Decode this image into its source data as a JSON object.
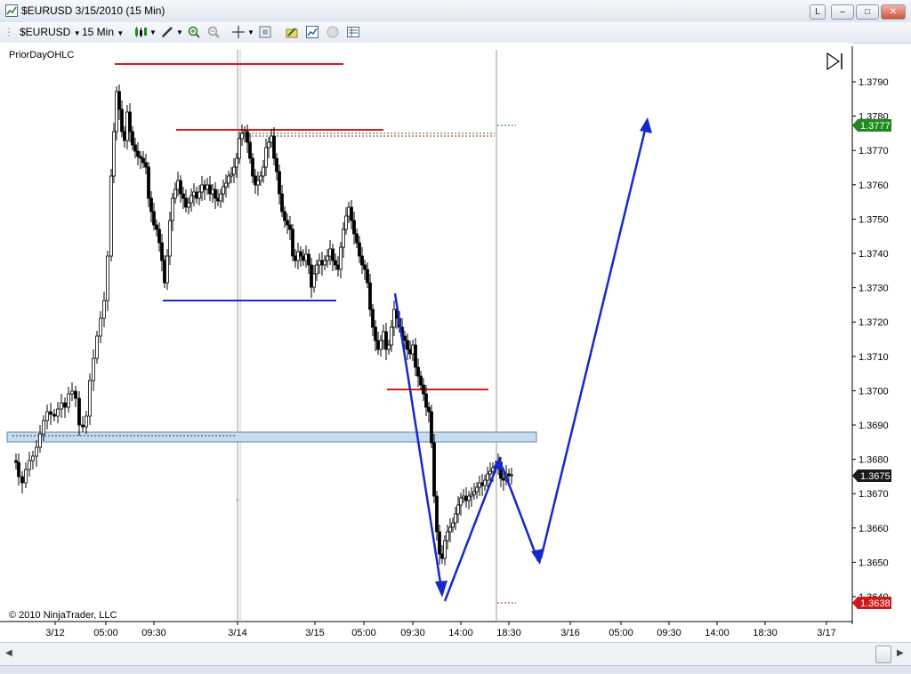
{
  "window": {
    "title": "$EURUSD  3/15/2010 (15 Min)",
    "controls": {
      "link": "L",
      "minimize": "–",
      "maximize": "□",
      "close": "✕"
    }
  },
  "toolbar": {
    "instrument": "$EURUSD",
    "interval": "15 Min",
    "icons": [
      "bar-style-icon",
      "draw-pencil-icon",
      "zoom-in-icon",
      "zoom-out-icon",
      "crosshair-icon",
      "properties-icon",
      "strategy-icon",
      "chart-trader-icon",
      "ellipse-icon",
      "data-box-icon"
    ]
  },
  "chart": {
    "indicator_label": "PriorDayOHLC",
    "copyright": "© 2010 NinjaTrader, LLC",
    "y_ticks": [
      "1.3790",
      "1.3780",
      "1.3770",
      "1.3760",
      "1.3750",
      "1.3740",
      "1.3730",
      "1.3720",
      "1.3710",
      "1.3700",
      "1.3690",
      "1.3680",
      "1.3670",
      "1.3660",
      "1.3650",
      "1.3640"
    ],
    "x_ticks": [
      "3/12",
      "05:00",
      "09:30",
      "3/14",
      "3/15",
      "05:00",
      "09:30",
      "14:00",
      "18:30",
      "3/16",
      "05:00",
      "09:30",
      "14:00",
      "18:30",
      "3/17"
    ],
    "price_badges": [
      {
        "label": "1.3777",
        "color": "#1e8a1e"
      },
      {
        "label": "1.3675",
        "color": "#1a1a1a"
      },
      {
        "label": "1.3638",
        "color": "#d01818"
      }
    ],
    "colors": {
      "resistance": "#e0161b",
      "support": "#1b2fb4",
      "arrow": "#1628c8",
      "zone": "#c8dcef"
    }
  }
}
